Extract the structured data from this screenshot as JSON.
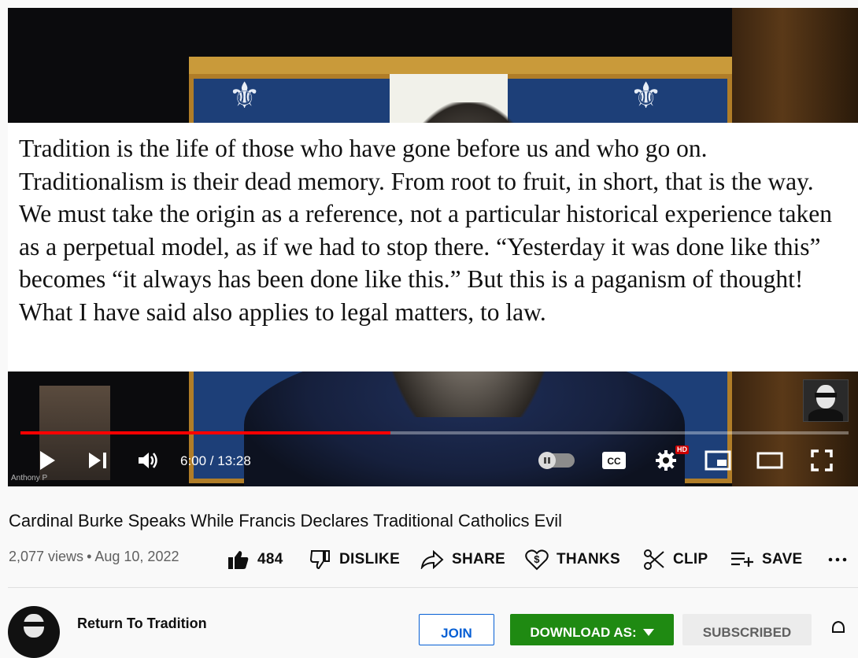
{
  "player": {
    "quote": "Tradition is the life of those who have gone before us and who go on. Traditionalism is their dead memory. From root to fruit, in short, that is the way. We must take the origin as a reference, not a particular historical experience taken as a perpetual model, as if we had to stop there. “Yesterday it was done like this” becomes “it always has been done like this.” But this is a paganism of thought! What I have said also applies to legal matters, to law.",
    "credit": "Anthony P",
    "progress_fraction": 0.447,
    "time_display": "6:00 / 13:28",
    "hd_badge": "HD",
    "icons": {
      "play": "play-icon",
      "next": "skip-next-icon",
      "volume": "volume-icon",
      "autoplay": "autoplay-toggle",
      "captions": "captions-icon",
      "settings": "settings-gear-icon",
      "miniplayer": "miniplayer-icon",
      "theater": "theater-mode-icon",
      "fullscreen": "fullscreen-icon"
    },
    "captions_label": "CC"
  },
  "video": {
    "title": "Cardinal Burke Speaks While Francis Declares Traditional Catholics Evil",
    "views": "2,077 views",
    "separator": "•",
    "date": "Aug 10, 2022"
  },
  "actions": {
    "like_count": "484",
    "dislike": "DISLIKE",
    "share": "SHARE",
    "thanks": "THANKS",
    "clip": "CLIP",
    "save": "SAVE"
  },
  "channel": {
    "name": "Return To Tradition",
    "join": "JOIN",
    "download": "DOWNLOAD AS:",
    "subscribed": "SUBSCRIBED"
  },
  "colors": {
    "progress": "#ff0000",
    "download_bg": "#1f8a12",
    "join_blue": "#065fd4"
  }
}
